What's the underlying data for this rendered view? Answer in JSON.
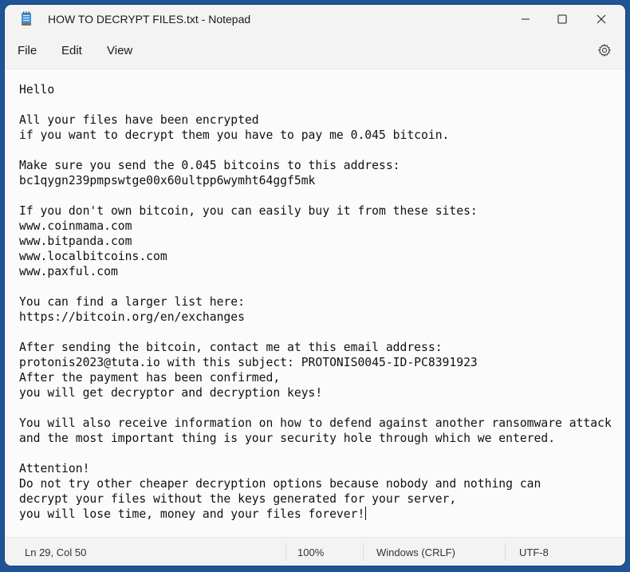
{
  "window": {
    "title": "HOW TO DECRYPT FILES.txt - Notepad",
    "app_icon": "notepad-icon",
    "controls": {
      "minimize": "minimize-icon",
      "maximize": "maximize-icon",
      "close": "close-icon"
    }
  },
  "menu": {
    "items": [
      {
        "label": "File"
      },
      {
        "label": "Edit"
      },
      {
        "label": "View"
      }
    ],
    "settings_icon": "gear-icon"
  },
  "editor": {
    "lines": [
      "Hello",
      "",
      "All your files have been encrypted",
      "if you want to decrypt them you have to pay me 0.045 bitcoin.",
      "",
      "Make sure you send the 0.045 bitcoins to this address:",
      "bc1qygn239pmpswtge00x60ultpp6wymht64ggf5mk",
      "",
      "If you don't own bitcoin, you can easily buy it from these sites:",
      "www.coinmama.com",
      "www.bitpanda.com",
      "www.localbitcoins.com",
      "www.paxful.com",
      "",
      "You can find a larger list here:",
      "https://bitcoin.org/en/exchanges",
      "",
      "After sending the bitcoin, contact me at this email address:",
      "protonis2023@tuta.io with this subject: PROTONIS0045-ID-PC8391923",
      "After the payment has been confirmed,",
      "you will get decryptor and decryption keys!",
      "",
      "You will also receive information on how to defend against another ransomware attack",
      "and the most important thing is your security hole through which we entered.",
      "",
      "Attention!",
      "Do not try other cheaper decryption options because nobody and nothing can",
      "decrypt your files without the keys generated for your server,",
      "you will lose time, money and your files forever!"
    ]
  },
  "status": {
    "position": "Ln 29, Col 50",
    "zoom": "100%",
    "line_ending": "Windows (CRLF)",
    "encoding": "UTF-8"
  }
}
